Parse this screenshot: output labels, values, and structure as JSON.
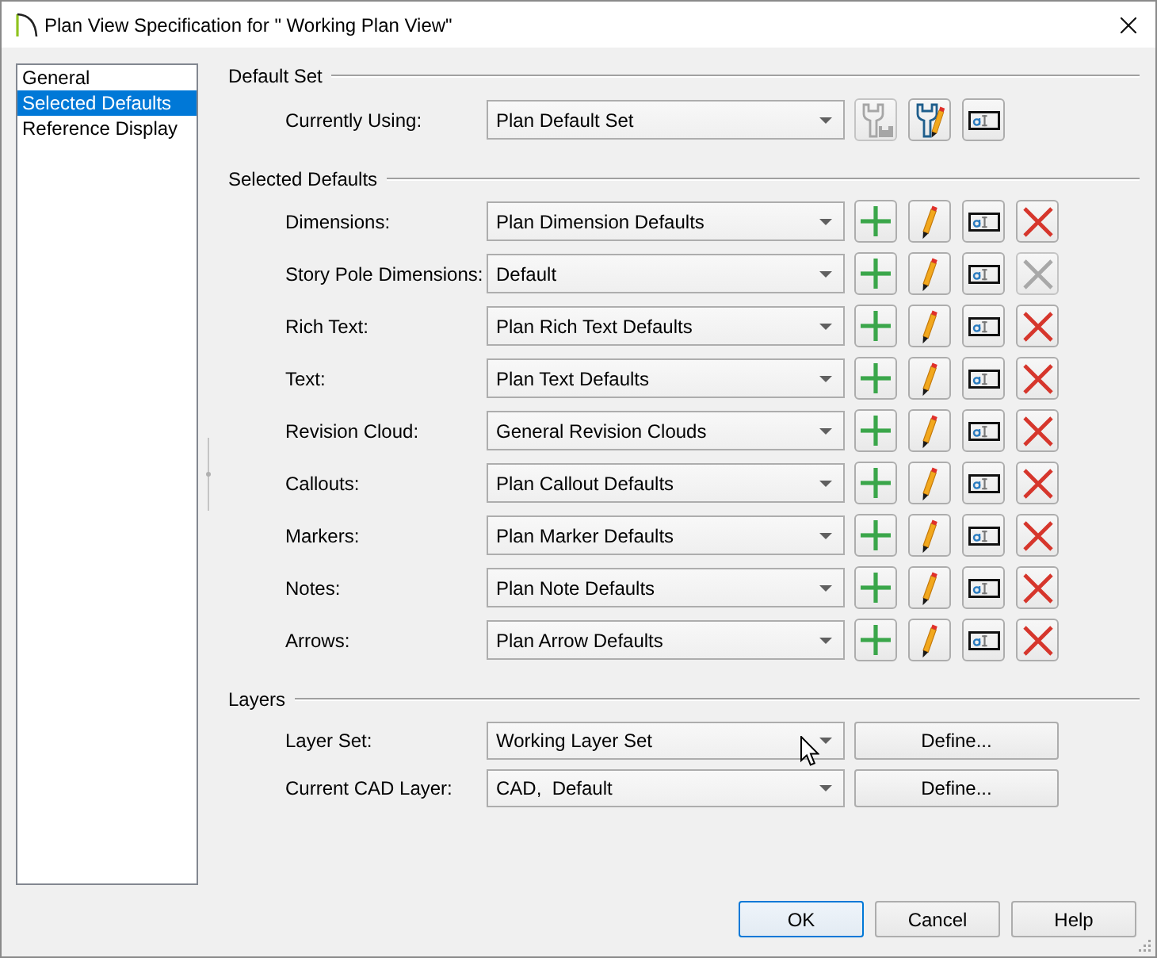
{
  "window": {
    "title": "Plan View Specification for \" Working Plan View\""
  },
  "sidebar": {
    "items": [
      {
        "label": "General",
        "selected": false
      },
      {
        "label": "Selected Defaults",
        "selected": true
      },
      {
        "label": "Reference Display",
        "selected": false
      }
    ]
  },
  "default_set": {
    "heading": "Default Set",
    "label": "Currently Using:",
    "value": "Plan Default Set",
    "buttons": [
      {
        "kind": "save-set",
        "disabled": true
      },
      {
        "kind": "edit-set",
        "disabled": false
      },
      {
        "kind": "text-style",
        "disabled": false
      }
    ]
  },
  "selected_defaults": {
    "heading": "Selected Defaults",
    "rows": [
      {
        "label": "Dimensions:",
        "value": "Plan Dimension Defaults",
        "delete_disabled": false
      },
      {
        "label": "Story Pole Dimensions:",
        "value": "Default",
        "delete_disabled": true
      },
      {
        "label": "Rich Text:",
        "value": "Plan Rich Text Defaults",
        "delete_disabled": false
      },
      {
        "label": "Text:",
        "value": "Plan Text Defaults",
        "delete_disabled": false
      },
      {
        "label": "Revision Cloud:",
        "value": "General Revision Clouds",
        "delete_disabled": false
      },
      {
        "label": "Callouts:",
        "value": "Plan Callout Defaults",
        "delete_disabled": false
      },
      {
        "label": "Markers:",
        "value": "Plan Marker Defaults",
        "delete_disabled": false
      },
      {
        "label": "Notes:",
        "value": "Plan Note Defaults",
        "delete_disabled": false
      },
      {
        "label": "Arrows:",
        "value": "Plan Arrow Defaults",
        "delete_disabled": false
      }
    ]
  },
  "layers": {
    "heading": "Layers",
    "rows": [
      {
        "label": "Layer Set:",
        "value": "Working Layer Set",
        "button": "Define..."
      },
      {
        "label": "Current CAD Layer:",
        "value": "CAD,  Default",
        "button": "Define..."
      }
    ]
  },
  "buttons": [
    {
      "label": "OK",
      "default": true
    },
    {
      "label": "Cancel",
      "default": false
    },
    {
      "label": "Help",
      "default": false
    }
  ]
}
